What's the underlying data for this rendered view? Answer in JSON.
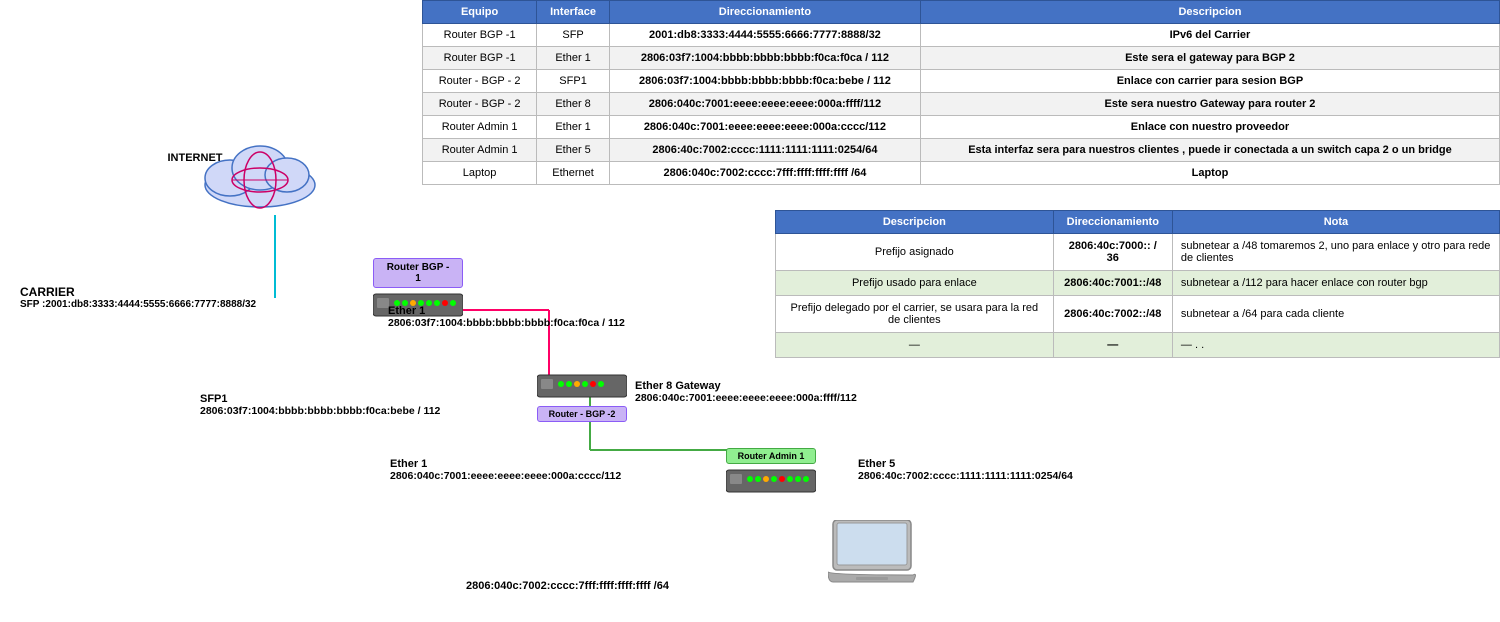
{
  "mainTable": {
    "headers": [
      "Equipo",
      "Interface",
      "Direccionamiento",
      "Descripcion"
    ],
    "rows": [
      {
        "equipo": "Router BGP -1",
        "interface": "SFP",
        "direccionamiento": "2001:db8:3333:4444:5555:6666:7777:8888/32",
        "descripcion": "IPv6 del Carrier"
      },
      {
        "equipo": "Router BGP -1",
        "interface": "Ether 1",
        "direccionamiento": "2806:03f7:1004:bbbb:bbbb:bbbb:f0ca:f0ca / 112",
        "descripcion": "Este sera el gateway para BGP 2"
      },
      {
        "equipo": "Router - BGP - 2",
        "interface": "SFP1",
        "direccionamiento": "2806:03f7:1004:bbbb:bbbb:bbbb:f0ca:bebe / 112",
        "descripcion": "Enlace con carrier para sesion BGP"
      },
      {
        "equipo": "Router - BGP - 2",
        "interface": "Ether 8",
        "direccionamiento": "2806:040c:7001:eeee:eeee:eeee:000a:ffff/112",
        "descripcion": "Este sera nuestro Gateway para router 2"
      },
      {
        "equipo": "Router Admin 1",
        "interface": "Ether 1",
        "direccionamiento": "2806:040c:7001:eeee:eeee:eeee:000a:cccc/112",
        "descripcion": "Enlace con nuestro proveedor"
      },
      {
        "equipo": "Router Admin 1",
        "interface": "Ether 5",
        "direccionamiento": "2806:40c:7002:cccc:1111:1111:1111:0254/64",
        "descripcion": "Esta interfaz sera para nuestros clientes , puede ir conectada a un switch capa 2 o un bridge"
      },
      {
        "equipo": "Laptop",
        "interface": "Ethernet",
        "direccionamiento": "2806:040c:7002:cccc:7fff:ffff:ffff:ffff /64",
        "descripcion": "Laptop"
      }
    ]
  },
  "secondTable": {
    "headers": [
      "Descripcion",
      "Direccionamiento",
      "Nota"
    ],
    "rows": [
      {
        "descripcion": "Prefijo asignado",
        "direccionamiento": "2806:40c:7000:: / 36",
        "nota": "subnetear a /48  tomaremos 2, uno para enlace y otro para rede de clientes",
        "style": "normal"
      },
      {
        "descripcion": "Prefijo usado para enlace",
        "direccionamiento": "2806:40c:7001::/48",
        "nota": "subnetear a /112 para hacer enlace con router bgp",
        "style": "green"
      },
      {
        "descripcion": "Prefijo delegado por el carrier, se usara para la red de clientes",
        "direccionamiento": "2806:40c:7002::/48",
        "nota": "subnetear a /64 para cada cliente",
        "style": "normal"
      },
      {
        "descripcion": "—",
        "direccionamiento": "—",
        "nota": "— . .",
        "style": "green"
      }
    ]
  },
  "diagram": {
    "internet": {
      "label": "INTERNET"
    },
    "carrier": {
      "label": "CARRIER",
      "sfp": "SFP :2001:db8:3333:4444:5555:6666:7777:8888/32"
    },
    "routerBGP1": {
      "label": "Router BGP -\n1",
      "ether1Label": "Ether 1",
      "ether1Addr": "2806:03f7:1004:bbbb:bbbb:bbbb:f0ca:f0ca / 112"
    },
    "routerBGP2": {
      "label": "Router - BGP -2",
      "sfp1Label": "SFP1",
      "sfp1Addr": "2806:03f7:1004:bbbb:bbbb:bbbb:f0ca:bebe / 112",
      "ether8Label": "Ether 8 Gateway",
      "ether8Addr": "2806:040c:7001:eeee:eeee:eeee:000a:ffff/112"
    },
    "routerAdmin1": {
      "label": "Router Admin 1",
      "ether1Label": "Ether 1",
      "ether1Addr": "2806:040c:7001:eeee:eeee:eeee:000a:cccc/112",
      "ether5Label": "Ether 5",
      "ether5Addr": "2806:40c:7002:cccc:1111:1111:1111:0254/64"
    },
    "laptop": {
      "ethAddr": "2806:040c:7002:cccc:7fff:ffff:ffff:ffff /64"
    }
  }
}
